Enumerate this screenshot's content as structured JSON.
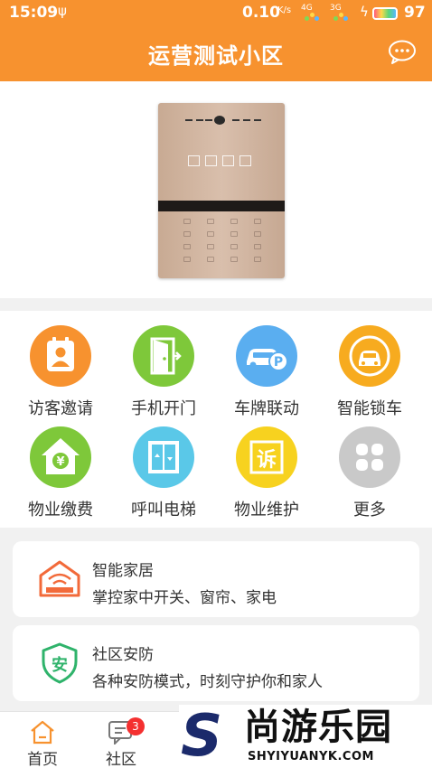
{
  "status": {
    "time": "15:09",
    "usb_icon": "usb-icon",
    "speed": "0.10",
    "speed_unit": "K/s",
    "net1": "4G",
    "net2": "3G",
    "battery": "97"
  },
  "header": {
    "title": "运营测试小区",
    "chat_icon": "chat-bubble-icon",
    "color": "#f7922f"
  },
  "menu": {
    "items": [
      {
        "label": "访客邀请",
        "icon": "visitor-invite-icon",
        "color": "#f7922f"
      },
      {
        "label": "手机开门",
        "icon": "door-open-icon",
        "color": "#7ec83a"
      },
      {
        "label": "车牌联动",
        "icon": "car-parking-icon",
        "color": "#5aaef0"
      },
      {
        "label": "智能锁车",
        "icon": "car-lock-icon",
        "color": "#f7ab1f"
      },
      {
        "label": "物业缴费",
        "icon": "property-fee-icon",
        "color": "#7ec83a"
      },
      {
        "label": "呼叫电梯",
        "icon": "elevator-icon",
        "color": "#5ac8e8"
      },
      {
        "label": "物业维护",
        "icon": "complaint-icon",
        "color": "#f7d21f"
      },
      {
        "label": "更多",
        "icon": "more-grid-icon",
        "color": "#c9c9c9"
      }
    ]
  },
  "cards": [
    {
      "title": "智能家居",
      "subtitle": "掌控家中开关、窗帘、家电",
      "icon": "smart-home-icon"
    },
    {
      "title": "社区安防",
      "subtitle": "各种安防模式，时刻守护你和家人",
      "icon": "security-shield-icon"
    }
  ],
  "bottom_nav": {
    "tabs": [
      {
        "label": "首页",
        "icon": "home-icon",
        "active": true
      },
      {
        "label": "社区",
        "icon": "community-chat-icon",
        "active": false
      }
    ],
    "badge": "3"
  },
  "watermark": {
    "letter": "S",
    "cn": "尚游乐园",
    "en": "SHYIYUANYK.COM"
  }
}
